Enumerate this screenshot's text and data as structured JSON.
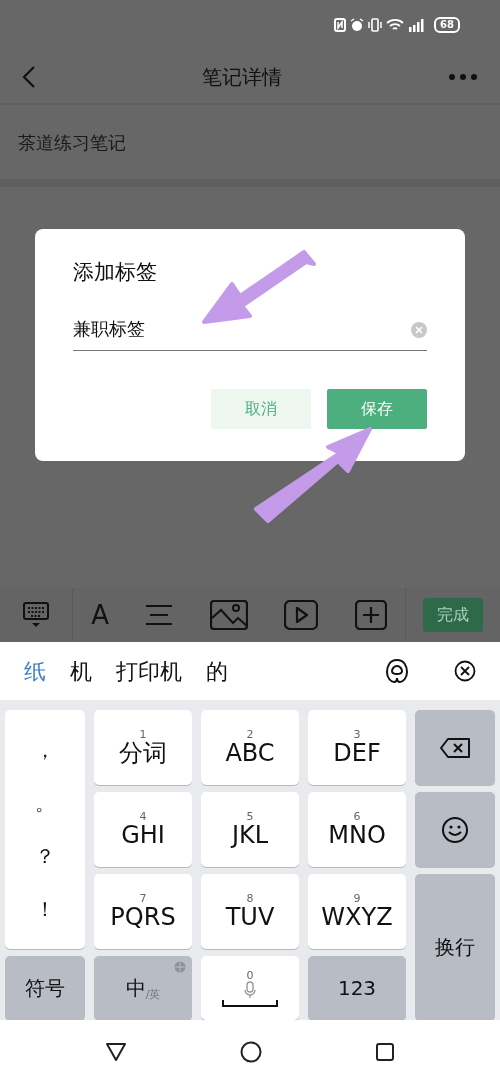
{
  "status_bar": {
    "battery": "68"
  },
  "header": {
    "title": "笔记详情"
  },
  "note": {
    "title": "茶道练习笔记"
  },
  "dialog": {
    "title": "添加标签",
    "field": {
      "value": "兼职标签"
    },
    "buttons": [
      {
        "label": "取消",
        "kind": "secondary"
      },
      {
        "label": "保存",
        "kind": "primary"
      }
    ]
  },
  "annotation_arrows": [
    {
      "kind": "down_left"
    },
    {
      "kind": "up_right"
    }
  ],
  "toolbar": {
    "tools": [
      {
        "kind": "keyboard"
      },
      {
        "kind": "text",
        "label": "A"
      },
      {
        "kind": "align"
      },
      {
        "kind": "image"
      },
      {
        "kind": "video"
      },
      {
        "kind": "add"
      }
    ],
    "done": "完成"
  },
  "candidates": [
    {
      "text": "纸",
      "selected": true
    },
    {
      "text": "机",
      "selected": false
    },
    {
      "text": "打印机",
      "selected": false
    },
    {
      "text": "的",
      "selected": false
    }
  ],
  "keys": [
    {
      "kind": "punct",
      "items": [
        "，",
        "。",
        "？",
        "！"
      ]
    },
    {
      "kind": "letter",
      "digit": "1",
      "label": "分词"
    },
    {
      "kind": "letter",
      "digit": "2",
      "label": "ABC"
    },
    {
      "kind": "letter",
      "digit": "3",
      "label": "DEF"
    },
    {
      "kind": "backspace"
    },
    {
      "kind": "letter",
      "digit": "4",
      "label": "GHI"
    },
    {
      "kind": "letter",
      "digit": "5",
      "label": "JKL"
    },
    {
      "kind": "letter",
      "digit": "6",
      "label": "MNO"
    },
    {
      "kind": "emoji"
    },
    {
      "kind": "letter",
      "digit": "7",
      "label": "PQRS"
    },
    {
      "kind": "letter",
      "digit": "8",
      "label": "TUV"
    },
    {
      "kind": "letter",
      "digit": "9",
      "label": "WXYZ"
    },
    {
      "kind": "enter",
      "label": "换行"
    },
    {
      "kind": "function",
      "label": "符号"
    },
    {
      "kind": "lang",
      "label": "中",
      "sub": "/英"
    },
    {
      "kind": "space",
      "digit": "0"
    },
    {
      "kind": "function",
      "label": "123"
    }
  ]
}
